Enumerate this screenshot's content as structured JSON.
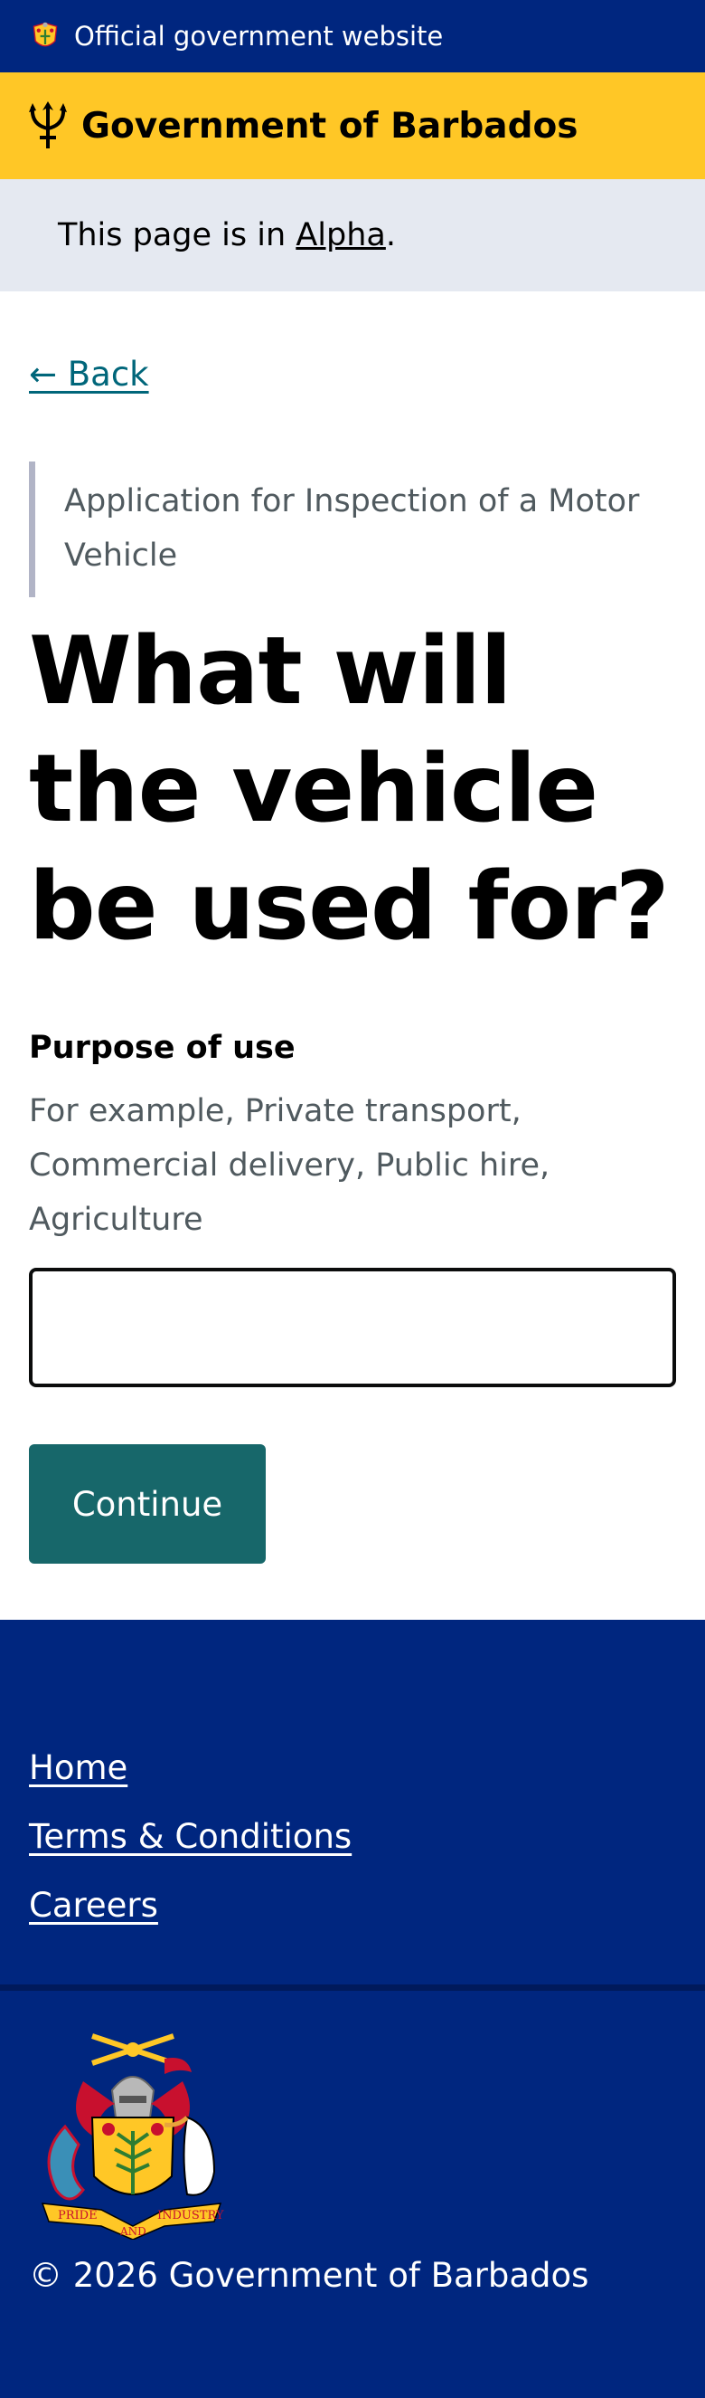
{
  "topbar": {
    "official_text": "Official government website",
    "crest_icon": "barbados-crest-icon"
  },
  "brandbar": {
    "title": "Government of Barbados",
    "logo_icon": "trident-icon",
    "background": "#ffc726"
  },
  "phase_banner": {
    "prefix": "This page is in",
    "phase_link": "Alpha",
    "suffix": "."
  },
  "main": {
    "back_link": "← Back",
    "caption": "Application for Inspection of a Motor Vehicle",
    "heading": "What will the vehicle be used for?",
    "field": {
      "label": "Purpose of use",
      "hint": "For example, Private transport, Commercial delivery, Public hire, Agriculture",
      "value": "",
      "placeholder": ""
    },
    "continue_button": "Continue",
    "button_color": "#17676a"
  },
  "footer": {
    "links": [
      {
        "label": "Home"
      },
      {
        "label": "Terms & Conditions"
      },
      {
        "label": "Careers"
      }
    ],
    "coat_of_arms_icon": "coat-of-arms-icon",
    "motto_left": "PRIDE",
    "motto_middle": "AND",
    "motto_right": "INDUSTRY",
    "copyright": "© 2026 Government of Barbados",
    "background": "#00267f"
  }
}
